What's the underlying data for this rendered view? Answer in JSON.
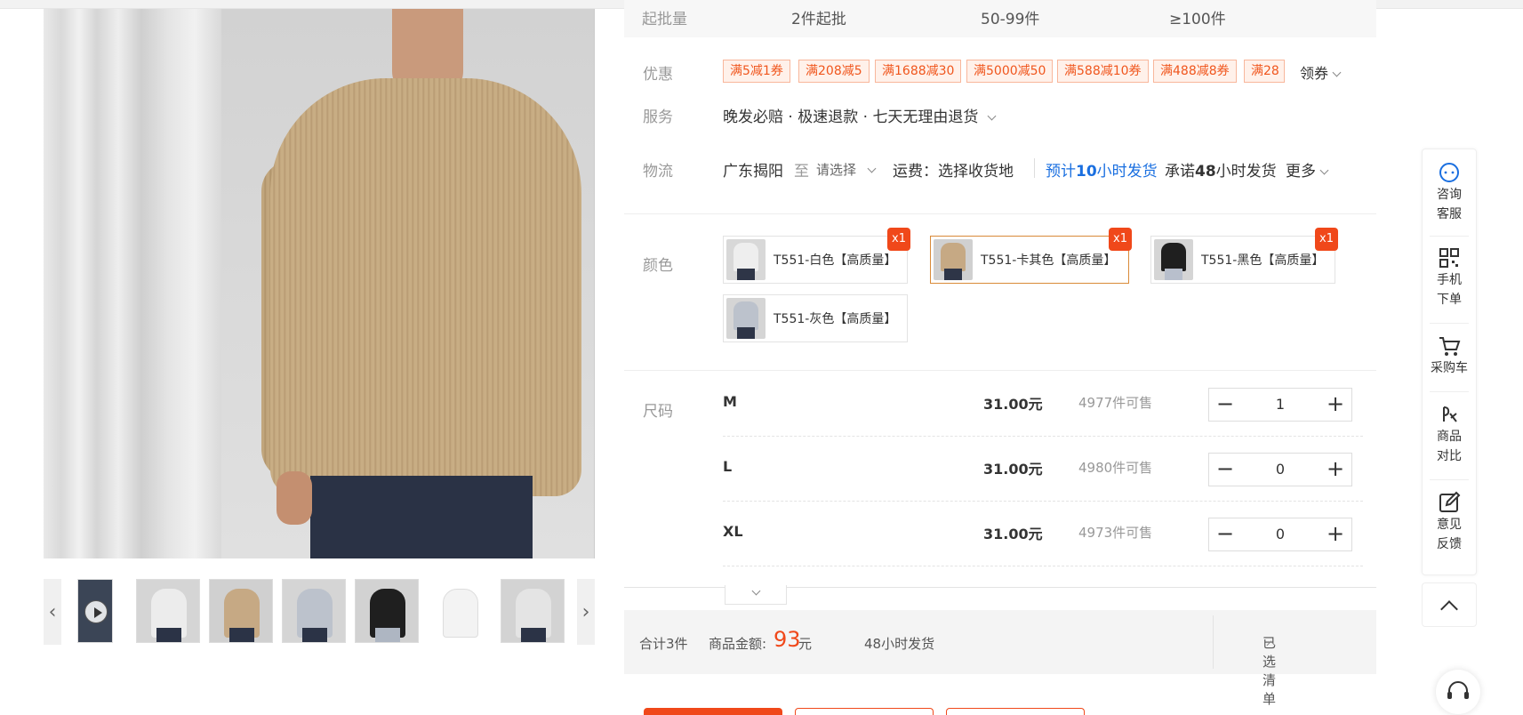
{
  "moq": {
    "label": "起批量",
    "tiers": [
      "2件起批",
      "50-99件",
      "≥100件"
    ]
  },
  "promotions": {
    "label": "优惠",
    "coupons": [
      "满5减1券",
      "满208减5",
      "满1688减30",
      "满5000减50",
      "满588减10券",
      "满488减8券",
      "满28"
    ],
    "get_label": "领券"
  },
  "service": {
    "label": "服务",
    "items": [
      "晚发必赔",
      "极速退款",
      "七天无理由退货"
    ],
    "separator": "·"
  },
  "logistics": {
    "label": "物流",
    "origin": "广东揭阳",
    "to": "至",
    "destination_placeholder": "请选择",
    "shipping_fee": "运费：选择收货地",
    "estimate_prefix": "预计",
    "estimate_hours": "10",
    "estimate_suffix": "小时发货",
    "promise_prefix": "承诺",
    "promise_hours": "48",
    "promise_suffix": "小时发货",
    "more": "更多"
  },
  "colors": {
    "label": "颜色",
    "options": [
      {
        "name": "T551-白色【高质量】",
        "badge": "x1",
        "swatch": "#e9e6df",
        "selected": false
      },
      {
        "name": "T551-卡其色【高质量】",
        "badge": "x1",
        "swatch": "#c6a984",
        "selected": true
      },
      {
        "name": "T551-黑色【高质量】",
        "badge": "x1",
        "swatch": "#1f1f1f",
        "selected": false
      },
      {
        "name": "T551-灰色【高质量】",
        "badge": "",
        "swatch": "#bcc2cc",
        "selected": false
      }
    ]
  },
  "sizes": {
    "label": "尺码",
    "rows": [
      {
        "size": "M",
        "price": "31.00元",
        "stock": "4977件可售",
        "qty": "1"
      },
      {
        "size": "L",
        "price": "31.00元",
        "stock": "4980件可售",
        "qty": "0"
      },
      {
        "size": "XL",
        "price": "31.00元",
        "stock": "4973件可售",
        "qty": "0"
      }
    ],
    "minus_symbol": "−",
    "plus_symbol": "+"
  },
  "summary": {
    "total_label": "合计3件",
    "amount_label": "商品金额:",
    "amount": "93",
    "amount_unit": "元",
    "ship_time": "48小时发货",
    "selected_list": "已选清单"
  },
  "sidebar": {
    "items": [
      {
        "line1": "咨询",
        "line2": "客服",
        "icon": "chat-icon"
      },
      {
        "line1": "手机",
        "line2": "下单",
        "icon": "qrcode-icon"
      },
      {
        "line1": "采购车",
        "line2": "",
        "icon": "cart-icon"
      },
      {
        "line1": "商品",
        "line2": "对比",
        "icon": "compare-icon"
      },
      {
        "line1": "意见",
        "line2": "反馈",
        "icon": "edit-icon"
      }
    ]
  },
  "colors_theme": {
    "accent": "#f0481a",
    "link_blue": "#1a6fe0",
    "selected_border": "#d98a38"
  }
}
